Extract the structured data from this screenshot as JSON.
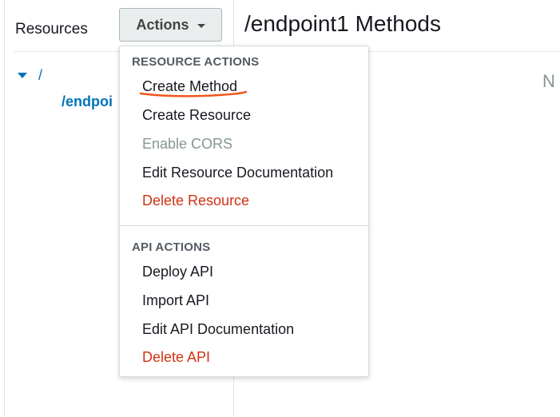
{
  "sidebar": {
    "title": "Resources",
    "tree": {
      "root": "/",
      "child": "/endpoi"
    }
  },
  "toolbar": {
    "actions_label": "Actions"
  },
  "main": {
    "title": "/endpoint1 Methods",
    "hint_text": "N"
  },
  "menu": {
    "resource_section": "RESOURCE ACTIONS",
    "resource_items": [
      {
        "label": "Create Method"
      },
      {
        "label": "Create Resource"
      },
      {
        "label": "Enable CORS"
      },
      {
        "label": "Edit Resource Documentation"
      },
      {
        "label": "Delete Resource"
      }
    ],
    "api_section": "API ACTIONS",
    "api_items": [
      {
        "label": "Deploy API"
      },
      {
        "label": "Import API"
      },
      {
        "label": "Edit API Documentation"
      },
      {
        "label": "Delete API"
      }
    ]
  },
  "colors": {
    "link": "#0073bb",
    "danger": "#d13212",
    "disabled": "#879596",
    "annotation": "#f0561a"
  }
}
